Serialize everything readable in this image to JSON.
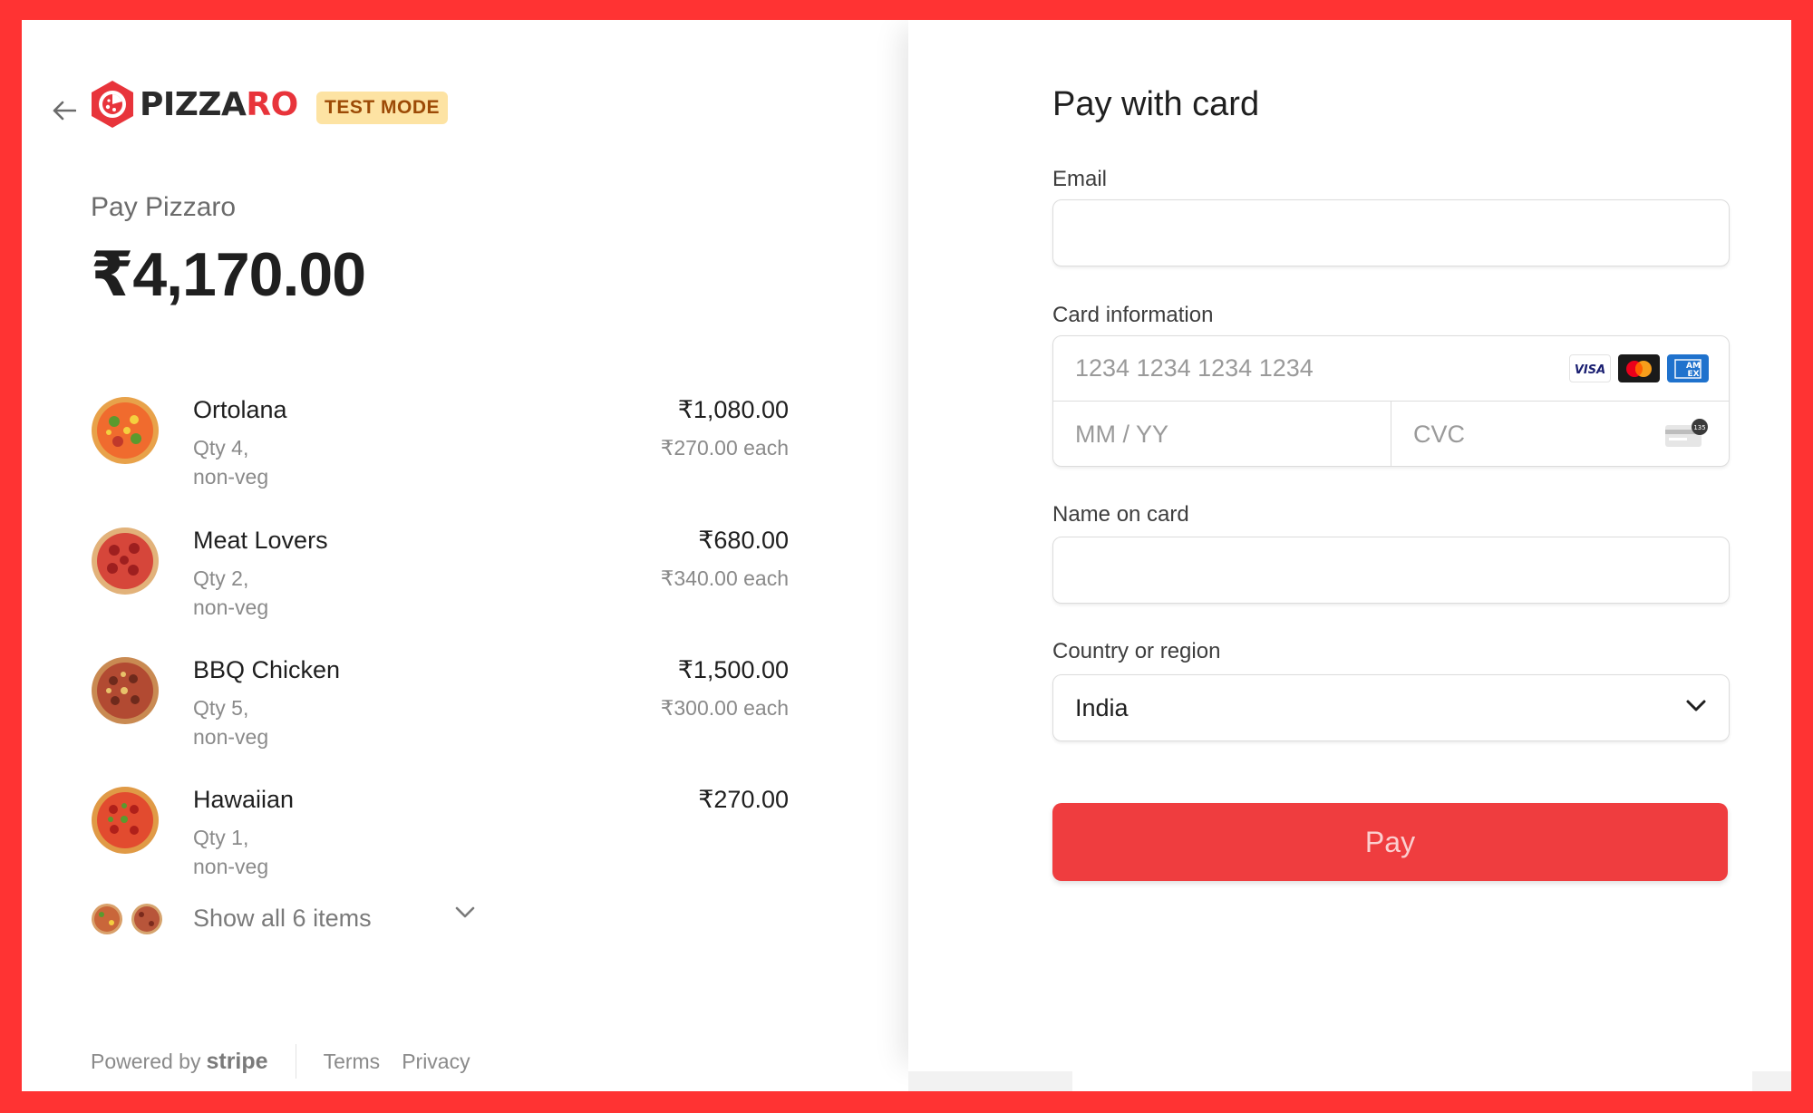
{
  "brand": {
    "name_dark": "PIZZA",
    "name_red": "RO",
    "test_mode_badge": "TEST MODE",
    "accent_color": "#e8343b"
  },
  "summary": {
    "pay_to": "Pay Pizzaro",
    "total": "₹4,170.00"
  },
  "items": [
    {
      "name": "Ortolana",
      "qty": "Qty 4,",
      "category": "non-veg",
      "price": "₹1,080.00",
      "each": "₹270.00 each"
    },
    {
      "name": "Meat Lovers",
      "qty": "Qty 2,",
      "category": "non-veg",
      "price": "₹680.00",
      "each": "₹340.00 each"
    },
    {
      "name": "BBQ Chicken",
      "qty": "Qty 5,",
      "category": "non-veg",
      "price": "₹1,500.00",
      "each": "₹300.00 each"
    },
    {
      "name": "Hawaiian",
      "qty": "Qty 1,",
      "category": "non-veg",
      "price": "₹270.00",
      "each": ""
    }
  ],
  "show_all": {
    "label": "Show all 6 items"
  },
  "footer": {
    "powered_by": "Powered by",
    "stripe": "stripe",
    "terms": "Terms",
    "privacy": "Privacy"
  },
  "form": {
    "title": "Pay with card",
    "email_label": "Email",
    "email_value": "",
    "card_label": "Card information",
    "card_number_placeholder": "1234 1234 1234 1234",
    "expiry_placeholder": "MM / YY",
    "cvc_placeholder": "CVC",
    "card_brands": [
      "visa-icon",
      "mastercard-icon",
      "amex-icon"
    ],
    "name_label": "Name on card",
    "name_value": "",
    "country_label": "Country or region",
    "country_value": "India",
    "pay_label": "Pay",
    "pay_color": "#ef3d3f"
  }
}
